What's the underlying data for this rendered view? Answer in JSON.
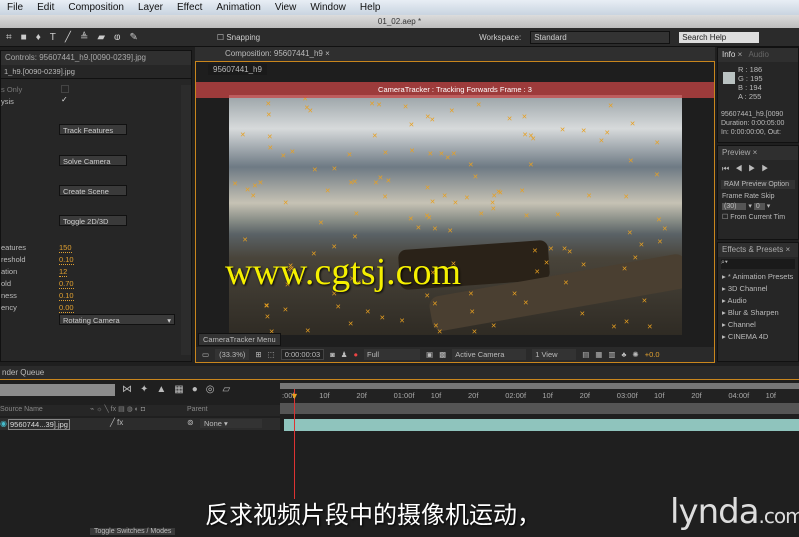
{
  "menu": [
    "File",
    "Edit",
    "Composition",
    "Layer",
    "Effect",
    "Animation",
    "View",
    "Window",
    "Help"
  ],
  "window_title": "01_02.aep *",
  "toolbar": {
    "snapping": "Snapping",
    "workspace_label": "Workspace:",
    "workspace_value": "Standard",
    "search_placeholder": "Search Help"
  },
  "effect_controls": {
    "tab": "Controls: 95607441_h9.[0090-0239].jpg",
    "layer": "1_h9.[0090-0239].jpg",
    "rows": [
      {
        "label": "s Only"
      },
      {
        "label": "ysis"
      }
    ],
    "buttons": [
      "Track Features",
      "Solve Camera",
      "Create Scene",
      "Toggle 2D/3D"
    ],
    "params": [
      {
        "label": "eatures",
        "value": "150"
      },
      {
        "label": "reshold",
        "value": "0.10"
      },
      {
        "label": "ation",
        "value": "12"
      },
      {
        "label": "old",
        "value": "0.70"
      },
      {
        "label": "ness",
        "value": "0.10"
      },
      {
        "label": "ency",
        "value": "0.00"
      }
    ],
    "mode": "Rotating Camera"
  },
  "composition": {
    "tab": "Composition: 95607441_h9",
    "subtab": "95607441_h9",
    "tracking_status": "CameraTracker : Tracking Forwards Frame : 3",
    "menu_button": "CameraTracker Menu",
    "zoom": "(33.3%)",
    "timecode": "0:00:00:03",
    "resolution": "Full",
    "camera": "Active Camera",
    "views": "1 View",
    "exposure": "+0.0"
  },
  "info": {
    "tabs": [
      "Info",
      "Audio"
    ],
    "r": "R : 186",
    "g": "G : 195",
    "b": "B : 194",
    "a": "A : 255",
    "swatch": "#bac3c2",
    "name": "95607441_h9.[0090",
    "duration": "Duration: 0:00:05:00",
    "inout": "In: 0:00:00:00, Out:"
  },
  "preview": {
    "tab": "Preview",
    "ram": "RAM Preview Option",
    "frame_rate_label": "Frame Rate",
    "skip_label": "Skip",
    "frame_rate": "(30)",
    "skip": "0",
    "from_current": "From Current Tim"
  },
  "effects": {
    "tab": "Effects & Presets",
    "items": [
      "* Animation Presets",
      "3D Channel",
      "Audio",
      "Blur & Sharpen",
      "Channel",
      "CINEMA 4D"
    ]
  },
  "timeline": {
    "tab": "nder Queue",
    "source_header": "Source Name",
    "parent_header": "Parent",
    "layer_name": "9560744...39].jpg",
    "parent": "None",
    "toggle": "Toggle Switches / Modes",
    "ruler": [
      ":00f",
      "10f",
      "20f",
      "01:00f",
      "10f",
      "20f",
      "02:00f",
      "10f",
      "20f",
      "03:00f",
      "10f",
      "20f",
      "04:00f",
      "10f"
    ]
  },
  "overlay": {
    "watermark": "www.cgtsj.com",
    "subtitle": "反求视频片段中的摄像机运动，",
    "logo": "lynda.com"
  }
}
